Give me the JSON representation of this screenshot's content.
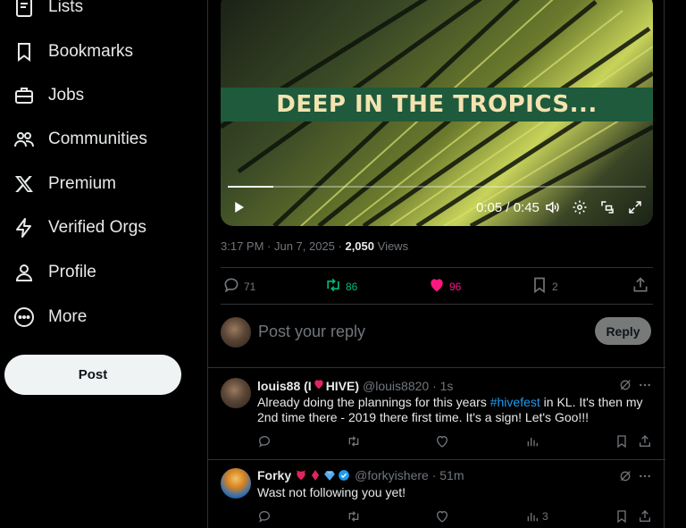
{
  "sidebar": {
    "items": [
      {
        "label": "Lists",
        "icon": "lists-icon"
      },
      {
        "label": "Bookmarks",
        "icon": "bookmark-icon"
      },
      {
        "label": "Jobs",
        "icon": "briefcase-icon"
      },
      {
        "label": "Communities",
        "icon": "communities-icon"
      },
      {
        "label": "Premium",
        "icon": "x-logo-icon"
      },
      {
        "label": "Verified Orgs",
        "icon": "lightning-icon"
      },
      {
        "label": "Profile",
        "icon": "person-icon"
      },
      {
        "label": "More",
        "icon": "more-circle-icon"
      }
    ],
    "post_label": "Post"
  },
  "post": {
    "video": {
      "banner_text": "DEEP IN THE TROPICS...",
      "time": "0:05 / 0:45",
      "progress_fraction": 0.11
    },
    "meta": {
      "time": "3:17 PM · Jun 7, 2025 · ",
      "views_count": "2,050",
      "views_label": " Views"
    },
    "actions": {
      "replies": "71",
      "reposts": "86",
      "likes": "96",
      "bookmarks": "2"
    },
    "colors": {
      "repost": "#00ba7c",
      "like": "#f91880",
      "link": "#1d9bf0"
    }
  },
  "reply_composer": {
    "placeholder": "Post your reply",
    "button_label": "Reply"
  },
  "replies": [
    {
      "name": "louis88 (I",
      "name_suffix": "HIVE)",
      "handle": "@louis8820 · 1s",
      "text_before": "Already doing the plannings for this years ",
      "hashtag": "#hivefest",
      "text_after": " in KL. It's then my 2nd time there - 2019 there first time. It's a sign! Let's Goo!!!",
      "views": ""
    },
    {
      "name": "Forky",
      "handle": "@forkyishere · 51m",
      "text": "Wast not following you yet!",
      "views": "3"
    }
  ]
}
